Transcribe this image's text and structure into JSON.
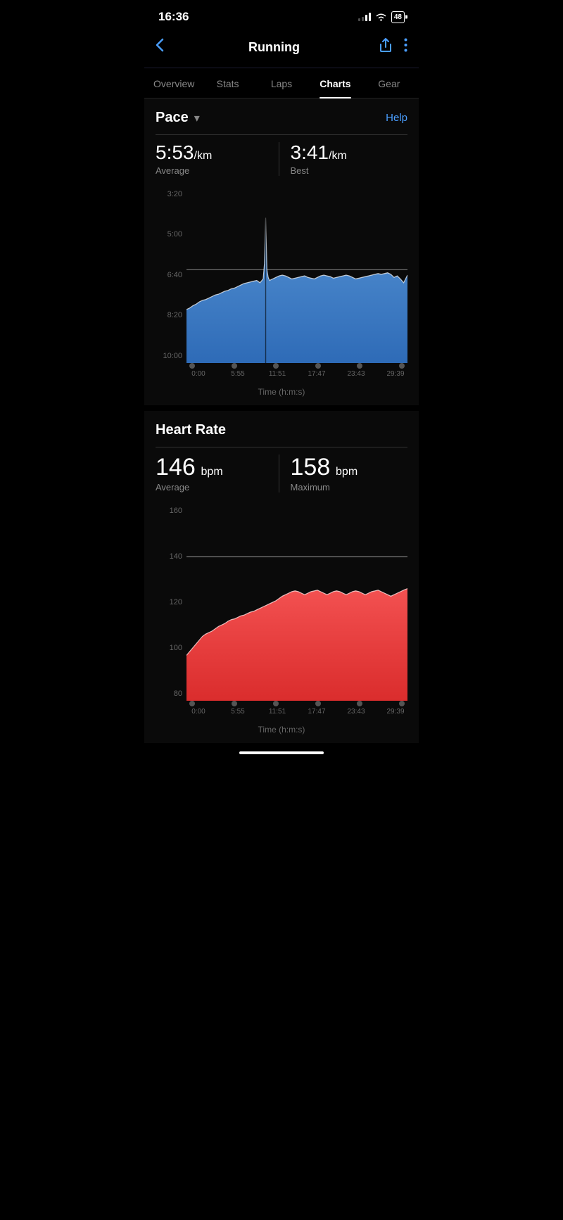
{
  "statusBar": {
    "time": "16:36",
    "battery": "48"
  },
  "header": {
    "title": "Running",
    "backLabel": "‹",
    "shareLabel": "↑",
    "moreLabel": "⋮"
  },
  "tabs": [
    {
      "id": "overview",
      "label": "Overview",
      "active": false
    },
    {
      "id": "stats",
      "label": "Stats",
      "active": false
    },
    {
      "id": "laps",
      "label": "Laps",
      "active": false
    },
    {
      "id": "charts",
      "label": "Charts",
      "active": true
    },
    {
      "id": "gear",
      "label": "Gear",
      "active": false
    }
  ],
  "paceChart": {
    "title": "Pace",
    "helpLabel": "Help",
    "averageValue": "5:53",
    "averageUnit": "/km",
    "averageLabel": "Average",
    "bestValue": "3:41",
    "bestUnit": "/km",
    "bestLabel": "Best",
    "yLabels": [
      "3:20",
      "5:00",
      "6:40",
      "8:20",
      "10:00"
    ],
    "xLabels": [
      "0:00",
      "5:55",
      "11:51",
      "17:47",
      "23:43",
      "29:39"
    ],
    "xAxisTitle": "Time (h:m:s)"
  },
  "heartRateChart": {
    "title": "Heart Rate",
    "averageValue": "146",
    "averageUnit": "bpm",
    "averageLabel": "Average",
    "maxValue": "158",
    "maxUnit": "bpm",
    "maxLabel": "Maximum",
    "yLabels": [
      "160",
      "140",
      "120",
      "100",
      "80"
    ],
    "xLabels": [
      "0:00",
      "5:55",
      "11:51",
      "17:47",
      "23:43",
      "29:39"
    ],
    "xAxisTitle": "Time (h:m:s)"
  }
}
